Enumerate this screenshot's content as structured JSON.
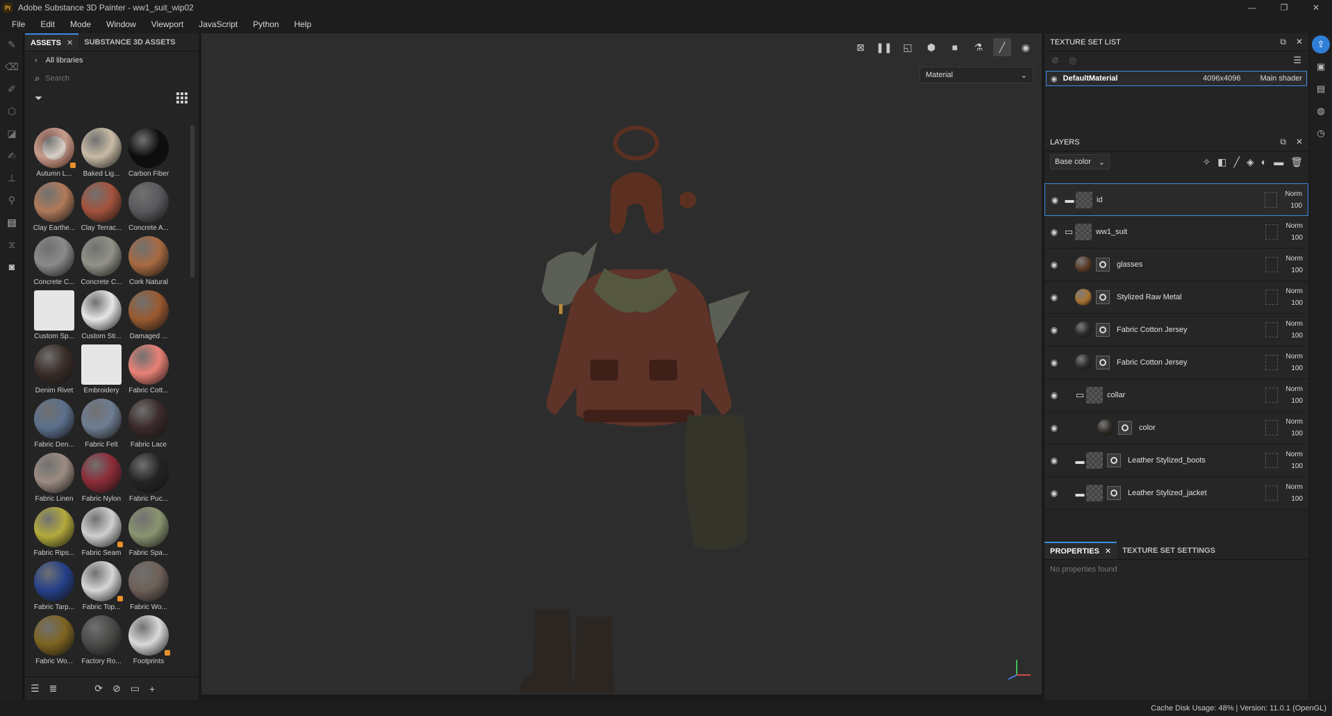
{
  "window": {
    "app_logo": "Pt",
    "title": "Adobe Substance 3D Painter - ww1_suit_wip02",
    "minimize": "—",
    "restore": "❐",
    "close": "✕"
  },
  "menu": [
    "File",
    "Edit",
    "Mode",
    "Window",
    "Viewport",
    "JavaScript",
    "Python",
    "Help"
  ],
  "assets": {
    "tabs": [
      {
        "label": "ASSETS",
        "close": "✕"
      },
      {
        "label": "SUBSTANCE 3D ASSETS"
      }
    ],
    "library": "All libraries",
    "search_placeholder": "Search",
    "items": [
      {
        "name": "Autumn L...",
        "color": "#d9cfc6",
        "accent": "#a33a1c",
        "badge": true
      },
      {
        "name": "Baked Lig...",
        "color": "#c9bba6"
      },
      {
        "name": "Carbon Fiber",
        "color": "#0d0d0d"
      },
      {
        "name": "Clay Earthe...",
        "color": "#b07a5a"
      },
      {
        "name": "Clay Terrac...",
        "color": "#a4533c"
      },
      {
        "name": "Concrete A...",
        "color": "#5a5a5e"
      },
      {
        "name": "Concrete C...",
        "color": "#8a8a8a"
      },
      {
        "name": "Concrete C...",
        "color": "#929288"
      },
      {
        "name": "Cork Natural",
        "color": "#a86a42"
      },
      {
        "name": "Custom Sp...",
        "color": "#e6e6e6",
        "square": true
      },
      {
        "name": "Custom Sti...",
        "color": "#e6e6e6"
      },
      {
        "name": "Damaged ...",
        "color": "#9a5a30"
      },
      {
        "name": "Denim Rivet",
        "color": "#3a2e28"
      },
      {
        "name": "Embroidery",
        "color": "#e6e6e6",
        "square": true
      },
      {
        "name": "Fabric Cott...",
        "color": "#e88176"
      },
      {
        "name": "Fabric Den...",
        "color": "#5c708c"
      },
      {
        "name": "Fabric Felt",
        "color": "#6e7d92"
      },
      {
        "name": "Fabric Lace",
        "color": "#3c2a2a"
      },
      {
        "name": "Fabric Linen",
        "color": "#9c8c82"
      },
      {
        "name": "Fabric Nylon",
        "color": "#8c2c38"
      },
      {
        "name": "Fabric Puc...",
        "color": "#242424"
      },
      {
        "name": "Fabric Rips...",
        "color": "#b3aa3c"
      },
      {
        "name": "Fabric Seam",
        "color": "#cfcfcf",
        "badge": true
      },
      {
        "name": "Fabric Spa...",
        "color": "#8a9470"
      },
      {
        "name": "Fabric Tarp...",
        "color": "#26418a"
      },
      {
        "name": "Fabric Top...",
        "color": "#d6d6d6",
        "badge": true
      },
      {
        "name": "Fabric Wo...",
        "color": "#6e6058"
      },
      {
        "name": "Fabric Wo...",
        "color": "#7e6420"
      },
      {
        "name": "Factory Ro...",
        "color": "#4a4a48"
      },
      {
        "name": "Footprints",
        "color": "#d9d9d9",
        "badge": true
      }
    ]
  },
  "viewport": {
    "mode": "Material",
    "colors": {
      "jacket": "#5e3328",
      "jacket_dark": "#3f2018",
      "collar": "#55583e",
      "pants": "#35342a",
      "boots": "#2b2622",
      "helmet": "#5c3020",
      "scarf": "#5b5f55"
    }
  },
  "texture_set": {
    "title": "TEXTURE SET LIST",
    "row": {
      "name": "DefaultMaterial",
      "resolution": "4096x4096",
      "shader": "Main shader"
    }
  },
  "layers": {
    "title": "LAYERS",
    "channel": "Base color",
    "items": [
      {
        "name": "id",
        "type": "folder",
        "indent": 0,
        "mode": "Norm",
        "opacity": "100",
        "selected": true
      },
      {
        "name": "ww1_suit",
        "type": "folder-open",
        "indent": 0,
        "mode": "Norm",
        "opacity": "100"
      },
      {
        "name": "glasses",
        "type": "fill",
        "indent": 0,
        "mode": "Norm",
        "opacity": "100",
        "thumb": "#5a3a28"
      },
      {
        "name": "Stylized Raw Metal",
        "type": "fill",
        "indent": 0,
        "mode": "Norm",
        "opacity": "100",
        "thumb": "#a8732f"
      },
      {
        "name": "Fabric Cotton Jersey",
        "type": "fill",
        "indent": 0,
        "mode": "Norm",
        "opacity": "100",
        "thumb": "#2a2a2a"
      },
      {
        "name": "Fabric Cotton Jersey",
        "type": "fill",
        "indent": 0,
        "mode": "Norm",
        "opacity": "100",
        "thumb": "#2a2a2a"
      },
      {
        "name": "collar",
        "type": "folder-open",
        "indent": 1,
        "mode": "Norm",
        "opacity": "100"
      },
      {
        "name": "color",
        "type": "fill",
        "indent": 2,
        "mode": "Norm",
        "opacity": "100",
        "thumb": "#2e2a24"
      },
      {
        "name": "Leather Stylized_boots",
        "type": "folder-mask",
        "indent": 1,
        "mode": "Norm",
        "opacity": "100"
      },
      {
        "name": "Leather Stylized_jacket",
        "type": "folder-mask",
        "indent": 1,
        "mode": "Norm",
        "opacity": "100"
      }
    ]
  },
  "properties": {
    "tabs": [
      {
        "label": "PROPERTIES",
        "close": "✕"
      },
      {
        "label": "TEXTURE SET SETTINGS"
      }
    ],
    "empty": "No properties found"
  },
  "status": {
    "text": "Cache Disk Usage:    48% | Version: 11.0.1 (OpenGL)"
  },
  "accent": "#3a8ee6"
}
